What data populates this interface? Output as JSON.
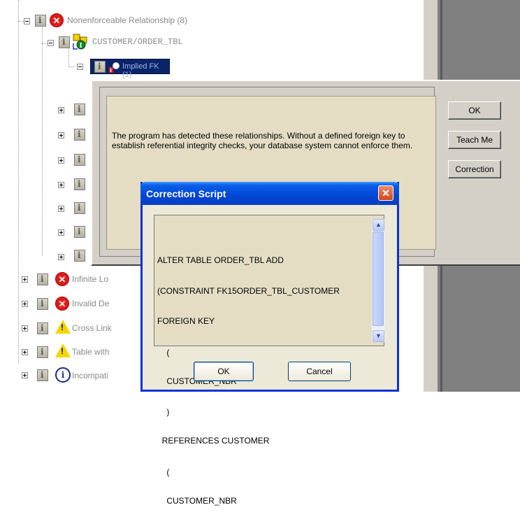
{
  "tree": {
    "nonenforceable": "Nonenforceable Relationship (8)",
    "customer_order": "CUSTOMER/ORDER_TBL",
    "implied_fk": "Implied FK (1)",
    "infinite": "Infinite Lo",
    "invalid": "Invalid De",
    "cross": "Cross Link",
    "table_with": "Table with",
    "incompat": "Incompati"
  },
  "main": {
    "message": "The program has detected these relationships.  Without a defined foreign key to establish referential integrity checks, your database system cannot enforce them.",
    "ok_label": "OK",
    "teach_label": "Teach Me",
    "correction_label": "Correction"
  },
  "dialog": {
    "title": "Correction Script",
    "close_glyph": "✕",
    "script_lines": [
      "ALTER TABLE ORDER_TBL ADD",
      "(CONSTRAINT FK15ORDER_TBL_CUSTOMER",
      "FOREIGN KEY",
      "    (",
      "    CUSTOMER_NBR",
      "    )",
      "  REFERENCES CUSTOMER",
      "    (",
      "    CUSTOMER_NBR"
    ],
    "ok_label": "OK",
    "cancel_label": "Cancel"
  },
  "colors": {
    "error": "#e01b1b",
    "warning": "#f2d600",
    "xp_title": "#0046d5"
  }
}
